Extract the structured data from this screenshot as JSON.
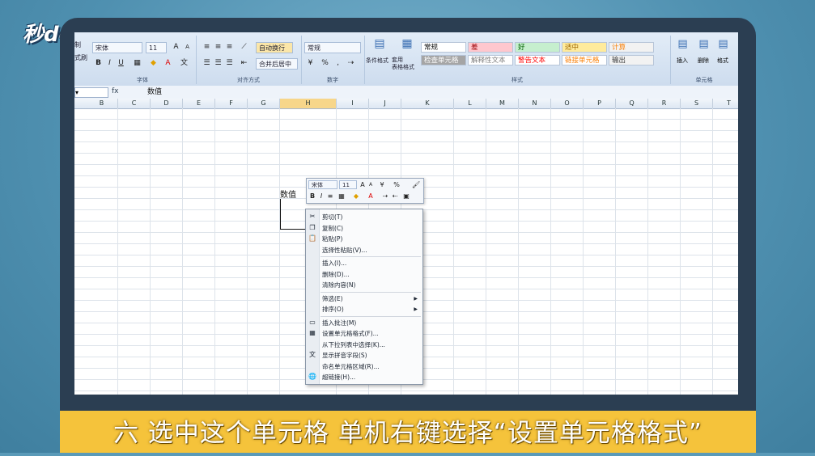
{
  "logo": {
    "text": "秒dong视频"
  },
  "ribbon": {
    "font_name": "宋体",
    "font_size": "11",
    "number_format": "常规",
    "wrap_text": "自动换行",
    "merge_center": "合并后居中",
    "percent": "%",
    "group_labels": {
      "font": "字体",
      "alignment": "对齐方式",
      "number": "数字",
      "styles": "样式",
      "cells": "单元格"
    },
    "conditional_format": "条件格式",
    "table_format": "套用\n表格格式",
    "insert": "插入",
    "delete": "删除",
    "format": "格式",
    "styles": [
      {
        "label": "常规",
        "bg": "#ffffff",
        "color": "#111111"
      },
      {
        "label": "差",
        "bg": "#ffc7ce",
        "color": "#9c0006"
      },
      {
        "label": "好",
        "bg": "#c6efce",
        "color": "#006100"
      },
      {
        "label": "适中",
        "bg": "#ffeb9c",
        "color": "#9c6500"
      },
      {
        "label": "计算",
        "bg": "#f2f2f2",
        "color": "#fa7d00"
      },
      {
        "label": "检查单元格",
        "bg": "#a5a5a5",
        "color": "#ffffff"
      },
      {
        "label": "解释性文本",
        "bg": "#ffffff",
        "color": "#7f7f7f"
      },
      {
        "label": "警告文本",
        "bg": "#ffffff",
        "color": "#ff0000"
      },
      {
        "label": "链接单元格",
        "bg": "#ffffff",
        "color": "#fa7d00"
      },
      {
        "label": "输出",
        "bg": "#f2f2f2",
        "color": "#3f3f3f"
      }
    ],
    "left_stub": [
      "制",
      "式刷"
    ]
  },
  "formula_bar": {
    "fx": "fx",
    "value": "数值"
  },
  "columns": [
    "B",
    "C",
    "D",
    "E",
    "F",
    "G",
    "H",
    "I",
    "J",
    "K",
    "L",
    "M",
    "N",
    "O",
    "P",
    "Q",
    "R",
    "S",
    "T"
  ],
  "selected_column": "H",
  "cell": {
    "text": "数值"
  },
  "mini_toolbar": {
    "font": "宋体",
    "size": "11",
    "percent": "%"
  },
  "context_menu": [
    {
      "label": "剪切(T)",
      "icon": "scissors-icon",
      "glyph": "✂"
    },
    {
      "label": "复制(C)",
      "icon": "copy-icon",
      "glyph": "❐"
    },
    {
      "label": "粘贴(P)",
      "icon": "paste-icon",
      "glyph": "📋"
    },
    {
      "label": "选择性粘贴(V)...",
      "icon": "",
      "glyph": ""
    },
    {
      "label": "插入(I)...",
      "icon": "",
      "glyph": "",
      "sep": true
    },
    {
      "label": "删除(D)...",
      "icon": "",
      "glyph": ""
    },
    {
      "label": "清除内容(N)",
      "icon": "",
      "glyph": ""
    },
    {
      "label": "筛选(E)",
      "icon": "",
      "glyph": "",
      "sep": true,
      "submenu": true
    },
    {
      "label": "排序(O)",
      "icon": "",
      "glyph": "",
      "submenu": true
    },
    {
      "label": "插入批注(M)",
      "icon": "comment-icon",
      "glyph": "▭",
      "sep": true
    },
    {
      "label": "设置单元格格式(F)...",
      "icon": "format-cells-icon",
      "glyph": "▦"
    },
    {
      "label": "从下拉列表中选择(K)...",
      "icon": "",
      "glyph": ""
    },
    {
      "label": "显示拼音字段(S)",
      "icon": "phonetic-icon",
      "glyph": "文"
    },
    {
      "label": "命名单元格区域(R)...",
      "icon": "",
      "glyph": ""
    },
    {
      "label": "超链接(H)...",
      "icon": "hyperlink-icon",
      "glyph": "🌐"
    }
  ],
  "caption": "六  选中这个单元格  单机右键选择“设置单元格格式”"
}
